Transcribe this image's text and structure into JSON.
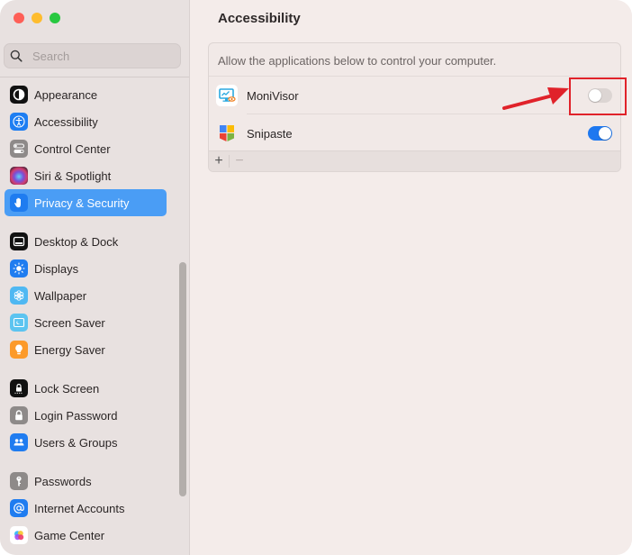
{
  "window": {
    "traffic_lights": [
      "close",
      "minimize",
      "zoom"
    ]
  },
  "sidebar": {
    "search": {
      "placeholder": "Search",
      "value": ""
    },
    "items": [
      {
        "label": "Appearance",
        "icon": "appearance-icon",
        "selected": false
      },
      {
        "label": "Accessibility",
        "icon": "accessibility-icon",
        "selected": false
      },
      {
        "label": "Control Center",
        "icon": "control-center-icon",
        "selected": false
      },
      {
        "label": "Siri & Spotlight",
        "icon": "siri-icon",
        "selected": false
      },
      {
        "label": "Privacy & Security",
        "icon": "hand-icon",
        "selected": true
      },
      {
        "label": "Desktop & Dock",
        "icon": "desktop-dock-icon",
        "selected": false
      },
      {
        "label": "Displays",
        "icon": "displays-sun-icon",
        "selected": false
      },
      {
        "label": "Wallpaper",
        "icon": "wallpaper-flower-icon",
        "selected": false
      },
      {
        "label": "Screen Saver",
        "icon": "screen-saver-icon",
        "selected": false
      },
      {
        "label": "Energy Saver",
        "icon": "lightbulb-icon",
        "selected": false
      },
      {
        "label": "Lock Screen",
        "icon": "lock-screen-icon",
        "selected": false
      },
      {
        "label": "Login Password",
        "icon": "padlock-icon",
        "selected": false
      },
      {
        "label": "Users & Groups",
        "icon": "users-icon",
        "selected": false
      },
      {
        "label": "Passwords",
        "icon": "key-icon",
        "selected": false
      },
      {
        "label": "Internet Accounts",
        "icon": "at-sign-icon",
        "selected": false
      },
      {
        "label": "Game Center",
        "icon": "game-center-icon",
        "selected": false
      }
    ]
  },
  "main": {
    "title": "Accessibility",
    "description": "Allow the applications below to control your computer.",
    "apps": [
      {
        "name": "MoniVisor",
        "icon": "monivisor-app-icon",
        "enabled": false
      },
      {
        "name": "Snipaste",
        "icon": "snipaste-app-icon",
        "enabled": true
      }
    ],
    "footer": {
      "add_label": "+",
      "remove_label": "−"
    }
  },
  "colors": {
    "accent": "#1e78f0",
    "selection": "#4a9df5",
    "annotation": "#e0222a"
  }
}
